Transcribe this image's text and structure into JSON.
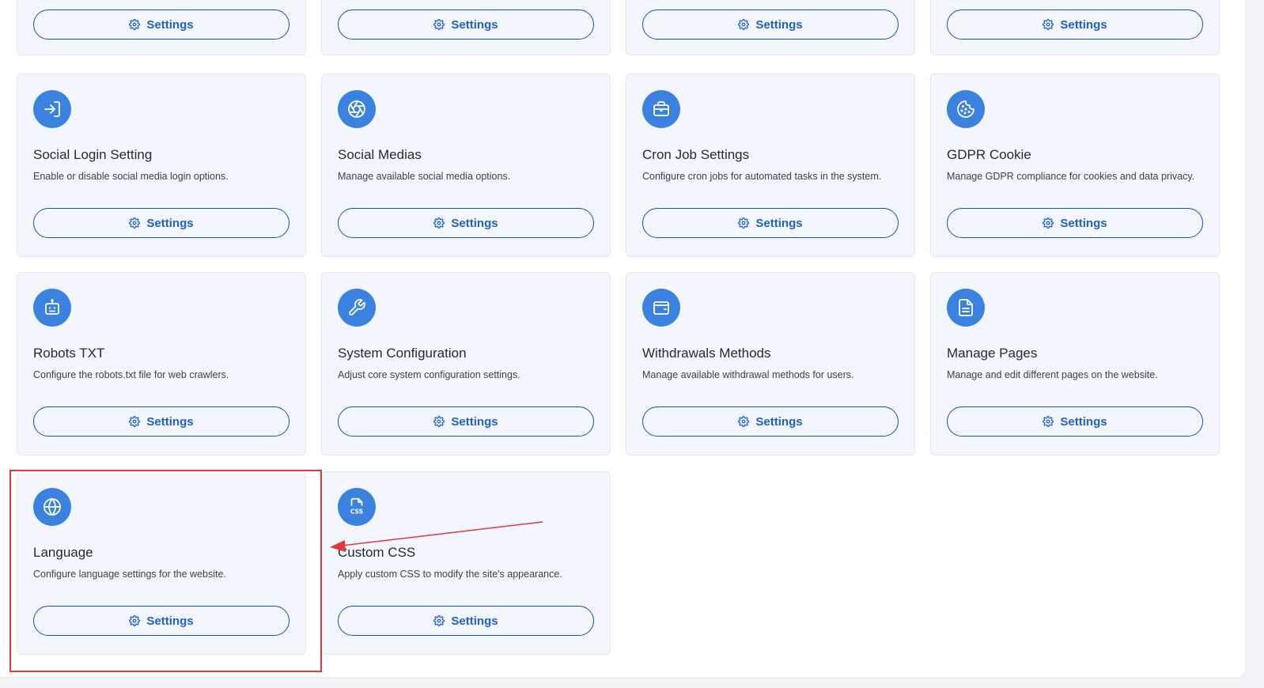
{
  "cards": [
    {
      "title": "",
      "description": "",
      "icon": "",
      "button_label": "Settings"
    },
    {
      "title": "",
      "description": "",
      "icon": "",
      "button_label": "Settings"
    },
    {
      "title": "",
      "description": "",
      "icon": "",
      "button_label": "Settings"
    },
    {
      "title": "",
      "description": "",
      "icon": "",
      "button_label": "Settings"
    },
    {
      "title": "Social Login Setting",
      "description": "Enable or disable social media login options.",
      "icon": "login-icon",
      "button_label": "Settings"
    },
    {
      "title": "Social Medias",
      "description": "Manage available social media options.",
      "icon": "aperture-icon",
      "button_label": "Settings"
    },
    {
      "title": "Cron Job Settings",
      "description": "Configure cron jobs for automated tasks in the system.",
      "icon": "briefcase-icon",
      "button_label": "Settings"
    },
    {
      "title": "GDPR Cookie",
      "description": "Manage GDPR compliance for cookies and data privacy.",
      "icon": "cookie-icon",
      "button_label": "Settings"
    },
    {
      "title": "Robots TXT",
      "description": "Configure the robots.txt file for web crawlers.",
      "icon": "robot-icon",
      "button_label": "Settings"
    },
    {
      "title": "System Configuration",
      "description": "Adjust core system configuration settings.",
      "icon": "wrench-icon",
      "button_label": "Settings"
    },
    {
      "title": "Withdrawals Methods",
      "description": "Manage available withdrawal methods for users.",
      "icon": "wallet-icon",
      "button_label": "Settings"
    },
    {
      "title": "Manage Pages",
      "description": "Manage and edit different pages on the website.",
      "icon": "document-icon",
      "button_label": "Settings"
    },
    {
      "title": "Language",
      "description": "Configure language settings for the website.",
      "icon": "globe-icon",
      "button_label": "Settings"
    },
    {
      "title": "Custom CSS",
      "description": "Apply custom CSS to modify the site's appearance.",
      "icon": "css-file-icon",
      "button_label": "Settings"
    }
  ],
  "colors": {
    "accent": "#3b82e0",
    "button_text": "#1f5fd0",
    "card_bg": "#f3f7fd",
    "annotation": "#e0393e"
  }
}
